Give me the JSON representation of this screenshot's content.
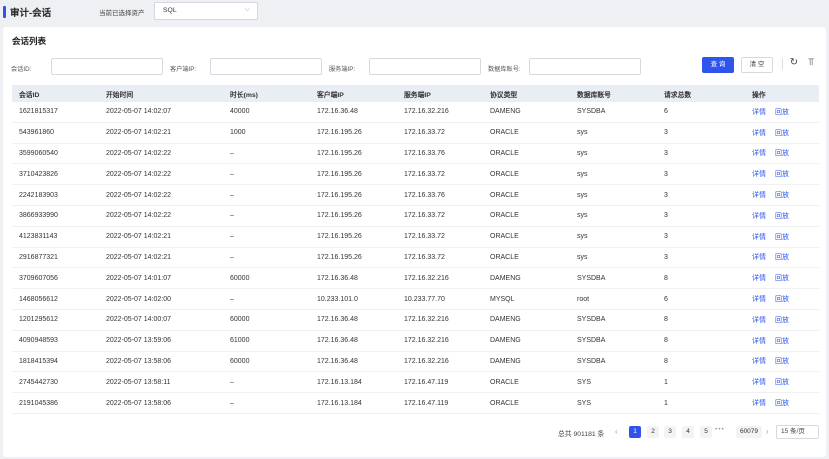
{
  "header": {
    "title": "审计-会话",
    "asset_label": "当前已选择资产",
    "asset_value": "SQL",
    "chevron_icon": "chevron-down-icon"
  },
  "card": {
    "title": "会话列表"
  },
  "filters": {
    "session_id_label": "会话ID:",
    "client_ip_label": "客户端IP:",
    "server_ip_label": "服务端IP:",
    "db_account_label": "数据库账号:",
    "query_label": "查 询",
    "clear_label": "清 空",
    "refresh_icon": "refresh-icon",
    "column-height_icon": "column-height-icon"
  },
  "table": {
    "columns": [
      "会话ID",
      "开始时间",
      "时长(ms)",
      "客户端IP",
      "服务端IP",
      "协议类型",
      "数据库账号",
      "请求总数",
      "操作"
    ],
    "action_detail": "详情",
    "action_replay": "回放",
    "rows": [
      [
        "1621815317",
        "2022-05-07 14:02:07",
        "40000",
        "172.16.36.48",
        "172.16.32.216",
        "DAMENG",
        "SYSDBA",
        "6"
      ],
      [
        "543961860",
        "2022-05-07 14:02:21",
        "1000",
        "172.16.195.26",
        "172.16.33.72",
        "ORACLE",
        "sys",
        "3"
      ],
      [
        "3599060540",
        "2022-05-07 14:02:22",
        "–",
        "172.16.195.26",
        "172.16.33.76",
        "ORACLE",
        "sys",
        "3"
      ],
      [
        "3710423826",
        "2022-05-07 14:02:22",
        "–",
        "172.16.195.26",
        "172.16.33.72",
        "ORACLE",
        "sys",
        "3"
      ],
      [
        "2242183903",
        "2022-05-07 14:02:22",
        "–",
        "172.16.195.26",
        "172.16.33.76",
        "ORACLE",
        "sys",
        "3"
      ],
      [
        "3866933990",
        "2022-05-07 14:02:22",
        "–",
        "172.16.195.26",
        "172.16.33.72",
        "ORACLE",
        "sys",
        "3"
      ],
      [
        "4123831143",
        "2022-05-07 14:02:21",
        "–",
        "172.16.195.26",
        "172.16.33.72",
        "ORACLE",
        "sys",
        "3"
      ],
      [
        "2916877321",
        "2022-05-07 14:02:21",
        "–",
        "172.16.195.26",
        "172.16.33.72",
        "ORACLE",
        "sys",
        "3"
      ],
      [
        "3709607056",
        "2022-05-07 14:01:07",
        "60000",
        "172.16.36.48",
        "172.16.32.216",
        "DAMENG",
        "SYSDBA",
        "8"
      ],
      [
        "1468056612",
        "2022-05-07 14:02:00",
        "–",
        "10.233.101.0",
        "10.233.77.70",
        "MYSQL",
        "root",
        "6"
      ],
      [
        "1201295612",
        "2022-05-07 14:00:07",
        "60000",
        "172.16.36.48",
        "172.16.32.216",
        "DAMENG",
        "SYSDBA",
        "8"
      ],
      [
        "4090948593",
        "2022-05-07 13:59:06",
        "61000",
        "172.16.36.48",
        "172.16.32.216",
        "DAMENG",
        "SYSDBA",
        "8"
      ],
      [
        "1818415394",
        "2022-05-07 13:58:06",
        "60000",
        "172.16.36.48",
        "172.16.32.216",
        "DAMENG",
        "SYSDBA",
        "8"
      ],
      [
        "2745442730",
        "2022-05-07 13:58:11",
        "–",
        "172.16.13.184",
        "172.16.47.119",
        "ORACLE",
        "SYS",
        "1"
      ],
      [
        "2191045386",
        "2022-05-07 13:58:06",
        "–",
        "172.16.13.184",
        "172.16.47.119",
        "ORACLE",
        "SYS",
        "1"
      ]
    ]
  },
  "pagination": {
    "total": "总共 901181 条",
    "prev": "‹",
    "pages": [
      "1",
      "2",
      "3",
      "4",
      "5"
    ],
    "dots": "•••",
    "last_page": "60079",
    "next": "›",
    "page_size": "15 条/页"
  },
  "colors": {
    "accent": "#2f54eb",
    "header_bg": "#e9edf4",
    "page_bg": "#eef0f4"
  }
}
